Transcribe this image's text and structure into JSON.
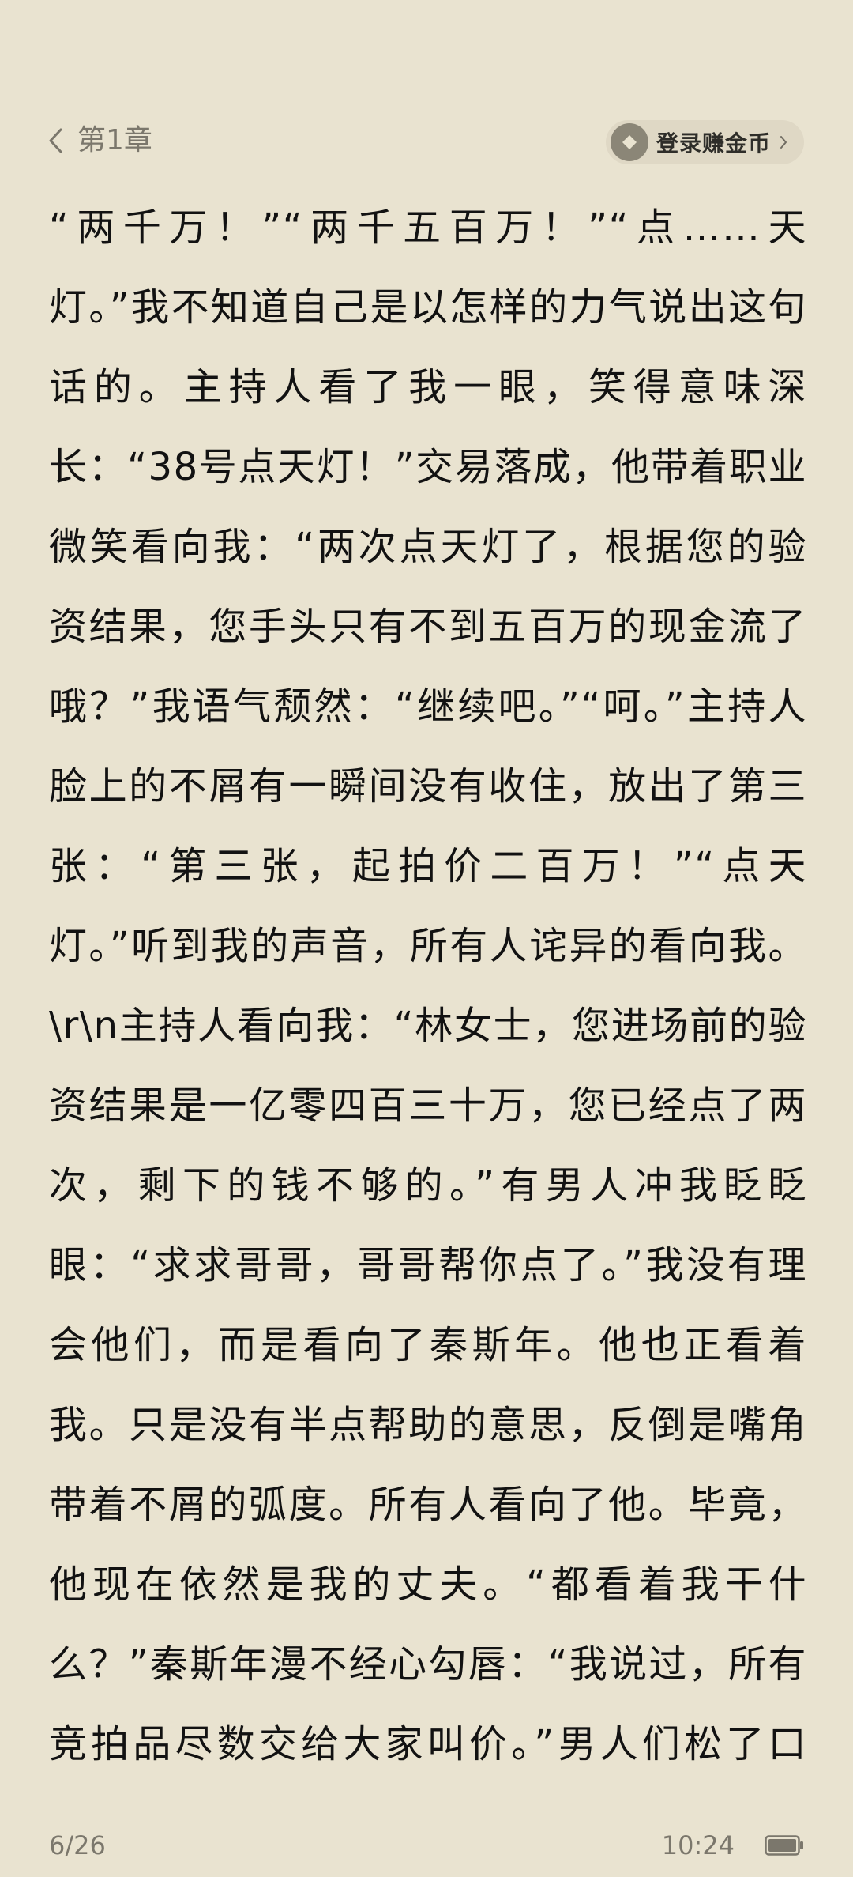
{
  "header": {
    "chapter": "第1章",
    "coin_button_label": "登录赚金币"
  },
  "content": {
    "text": "“两千万！”“两千五百万！”“点……天灯。”我不知道自己是以怎样的力气说出这句话的。主持人看了我一眼，笑得意味深长：“38号点天灯！”交易落成，他带着职业微笑看向我：“两次点天灯了，根据您的验资结果，您手头只有不到五百万的现金流了哦？”我语气颓然：“继续吧。”“呵。”主持人脸上的不屑有一瞬间没有收住，放出了第三张：“第三张，起拍价二百万！”“点天灯。”听到我的声音，所有人诧异的看向我。\\r\\n主持人看向我：“林女士，您进场前的验资结果是一亿零四百三十万，您已经点了两次，剩下的钱不够的。”有男人冲我眨眨眼：“求求哥哥，哥哥帮你点了。”我没有理会他们，而是看向了秦斯年。他也正看着我。只是没有半点帮助的意思，反倒是嘴角带着不屑的弧度。所有人看向了他。毕竟，他现在依然是我的丈夫。“都看着我干什么？”秦斯年漫不经心勾唇：“我说过，所有竞拍品尽数交给大家叫价。”男人们松了口气：“谢秦总不争之恩！”就在"
  },
  "footer": {
    "page": "6/26",
    "time": "10:24"
  },
  "icons": {
    "back": "chevron-left-icon",
    "coin": "coin-diamond-icon",
    "coin_chevron": "chevron-right-icon",
    "battery": "battery-icon"
  },
  "colors": {
    "background": "#e9e3d0",
    "text": "#121212",
    "muted": "#7b776c",
    "pill": "#dfd8c5"
  }
}
